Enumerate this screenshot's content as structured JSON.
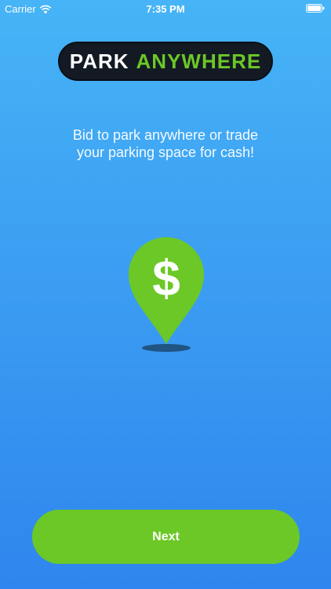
{
  "status_bar": {
    "carrier": "Carrier",
    "time": "7:35 PM",
    "wifi_icon": "wifi-icon",
    "battery_icon": "battery-icon"
  },
  "logo": {
    "word1": "PARK",
    "word2": "ANYWHERE"
  },
  "tagline": {
    "line1": "Bid to park anywhere or trade",
    "line2": "your parking space for cash!"
  },
  "pin": {
    "icon": "location-pin-dollar-icon",
    "symbol": "$"
  },
  "next_button": {
    "label": "Next"
  },
  "colors": {
    "background_top": "#46b4f6",
    "background_bottom": "#2f86ee",
    "accent_green": "#6cc826",
    "logo_dark": "#131a24"
  }
}
